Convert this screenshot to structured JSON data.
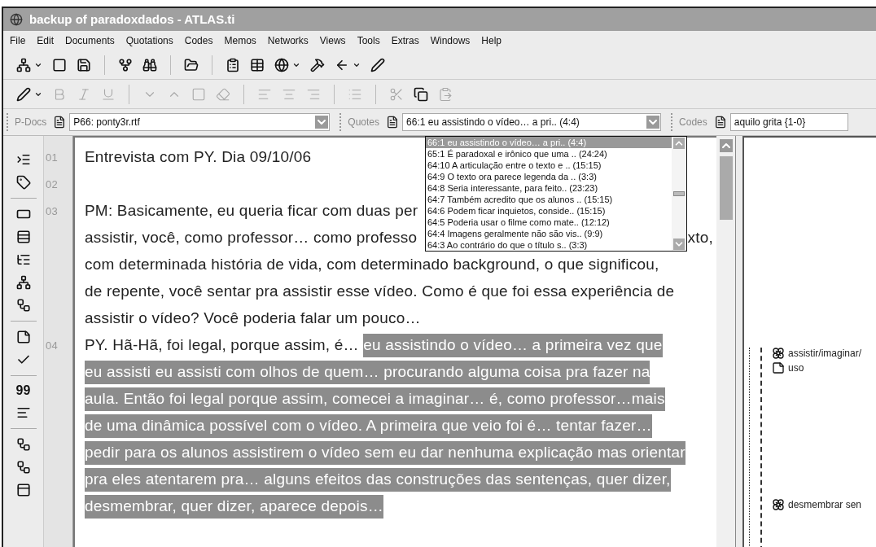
{
  "window": {
    "title": "backup of paradoxdados - ATLAS.ti"
  },
  "menu": [
    "File",
    "Edit",
    "Documents",
    "Quotations",
    "Codes",
    "Memos",
    "Networks",
    "Views",
    "Tools",
    "Extras",
    "Windows",
    "Help"
  ],
  "selectors": [
    {
      "label": "P-Docs",
      "value": "P66: ponty3r.rtf"
    },
    {
      "label": "Quotes",
      "value": "66:1 eu assistindo o vídeo… a pri.. (4:4)"
    },
    {
      "label": "Codes",
      "value": "aquilo grita {1-0}"
    }
  ],
  "side_toolbar": {
    "quote_glyph": "99"
  },
  "quote_list": [
    {
      "text": "66:1 eu assistindo o vídeo… a pri.. (4:4)",
      "selected": true
    },
    {
      "text": "65:1 É paradoxal e irônico que uma .. (24:24)",
      "selected": false
    },
    {
      "text": "64:10 A articulação entre o texto e .. (15:15)",
      "selected": false
    },
    {
      "text": "64:9 O texto ora parece legenda da .. (3:3)",
      "selected": false
    },
    {
      "text": "64:8 Seria interessante, para feito.. (23:23)",
      "selected": false
    },
    {
      "text": "64:7 Também acredito que os alunos .. (15:15)",
      "selected": false
    },
    {
      "text": "64:6 Podem ficar inquietos, conside.. (15:15)",
      "selected": false
    },
    {
      "text": "64:5 Poderia usar o filme como mate.. (12:12)",
      "selected": false
    },
    {
      "text": "64:4 Imagens geralmente não são vis.. (9:9)",
      "selected": false
    },
    {
      "text": "64:3 Ao contrário do que o título s.. (3:3)",
      "selected": false
    }
  ],
  "document": {
    "rows": [
      {
        "number": "01",
        "segments": [
          {
            "text": "Entrevista com PY. Dia 09/10/06",
            "highlighted": false
          }
        ]
      },
      {
        "number": "02",
        "segments": []
      },
      {
        "number": "03",
        "segments": [
          {
            "text": "PM: Basicamente, eu queria ficar com duas per",
            "highlighted": false
          }
        ]
      },
      {
        "segments": [
          {
            "text": "assistir, você, como professor… como professo",
            "highlighted": false
          }
        ],
        "right": "xto,"
      },
      {
        "segments": [
          {
            "text": "com determinada história de vida, com determinado background, o que significou,",
            "highlighted": false
          }
        ]
      },
      {
        "segments": [
          {
            "text": "de repente, você sentar pra assistir esse vídeo. Como é que foi essa experiência de",
            "highlighted": false
          }
        ]
      },
      {
        "segments": [
          {
            "text": "assistir o vídeo? Você poderia falar um pouco…",
            "highlighted": false
          }
        ]
      },
      {
        "number": "04",
        "segments": [
          {
            "text": "PY. Hã-Hã, foi legal, porque assim, é… ",
            "highlighted": false
          },
          {
            "text": "eu assistindo o vídeo… a primeira vez que",
            "highlighted": true
          }
        ]
      },
      {
        "segments": [
          {
            "text": "eu assisti eu assisti com olhos de quem… procurando alguma coisa pra fazer na",
            "highlighted": true
          }
        ]
      },
      {
        "segments": [
          {
            "text": "aula. Então foi legal porque assim, comecei a imaginar… é, como professor…mais",
            "highlighted": true
          }
        ]
      },
      {
        "segments": [
          {
            "text": "de uma dinâmica possível com o vídeo. A primeira que veio foi é… tentar fazer…",
            "highlighted": true
          }
        ]
      },
      {
        "segments": [
          {
            "text": "pedir para os alunos assistirem o vídeo sem eu dar nenhuma explicação mas orientar",
            "highlighted": true
          }
        ]
      },
      {
        "segments": [
          {
            "text": "pra eles atentarem pra… alguns efeitos das construções das sentenças, quer dizer,",
            "highlighted": true
          }
        ]
      },
      {
        "segments": [
          {
            "text": "desmembrar, quer dizer, aparece depois…",
            "highlighted": true
          }
        ]
      }
    ]
  },
  "margin_codes": [
    {
      "kind": "code",
      "label": "assistir/imaginar/"
    },
    {
      "kind": "memo",
      "label": "uso"
    },
    {
      "kind": "code",
      "label": "desmembrar sen"
    }
  ]
}
